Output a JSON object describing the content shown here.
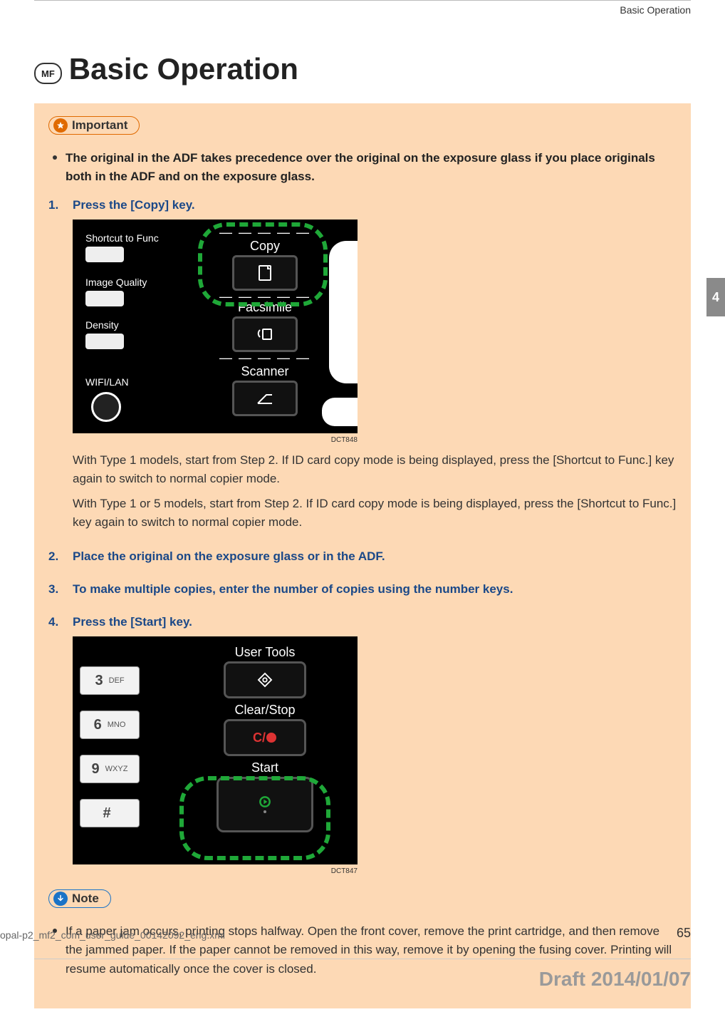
{
  "running_head": "Basic Operation",
  "mf_badge": "MF",
  "title": "Basic Operation",
  "important_label": "Important",
  "important_bullet": "The original in the ADF takes precedence over the original on the exposure glass if you place originals both in the ADF and on the exposure glass.",
  "steps": {
    "s1": {
      "num": "1.",
      "title": "Press the [Copy] key.",
      "para1": "With Type 1 models, start from Step 2. If ID card copy mode is being displayed, press the [Shortcut to Func.] key again to switch to normal copier mode.",
      "para2": "With Type 1 or 5 models, start from Step 2. If ID card copy mode is being displayed, press the [Shortcut to Func.] key again to switch to normal copier mode."
    },
    "s2": {
      "num": "2.",
      "title": "Place the original on the exposure glass or in the ADF."
    },
    "s3": {
      "num": "3.",
      "title": "To make multiple copies, enter the number of copies using the number keys."
    },
    "s4": {
      "num": "4.",
      "title": "Press the [Start] key."
    }
  },
  "fig1": {
    "shortcut": "Shortcut to Func",
    "image_quality": "Image Quality",
    "density": "Density",
    "wifi": "WIFI/LAN",
    "copy": "Copy",
    "facsimile": "Facsimile",
    "scanner": "Scanner",
    "label": "DCT848"
  },
  "fig2": {
    "keys": {
      "k3": {
        "big": "3",
        "sml": "DEF"
      },
      "k6": {
        "big": "6",
        "sml": "MNO"
      },
      "k9": {
        "big": "9",
        "sml": "WXYZ"
      },
      "hash": {
        "big": "#",
        "sml": ""
      }
    },
    "user_tools": "User Tools",
    "clear_stop": "Clear/Stop",
    "cs_symbol": "C/",
    "start": "Start",
    "label": "DCT847"
  },
  "note_label": "Note",
  "note_bullet": "If a paper jam occurs, printing stops halfway. Open the front cover, remove the print cartridge, and then remove the jammed paper. If the paper cannot be removed in this way, remove it by opening the fusing cover. Printing will resume automatically once the cover is closed.",
  "side_tab": "4",
  "footer_file": "opal-p2_mf2_com_user_guide_00142092_eng.xml",
  "page_number": "65",
  "draft": "Draft 2014/01/07"
}
